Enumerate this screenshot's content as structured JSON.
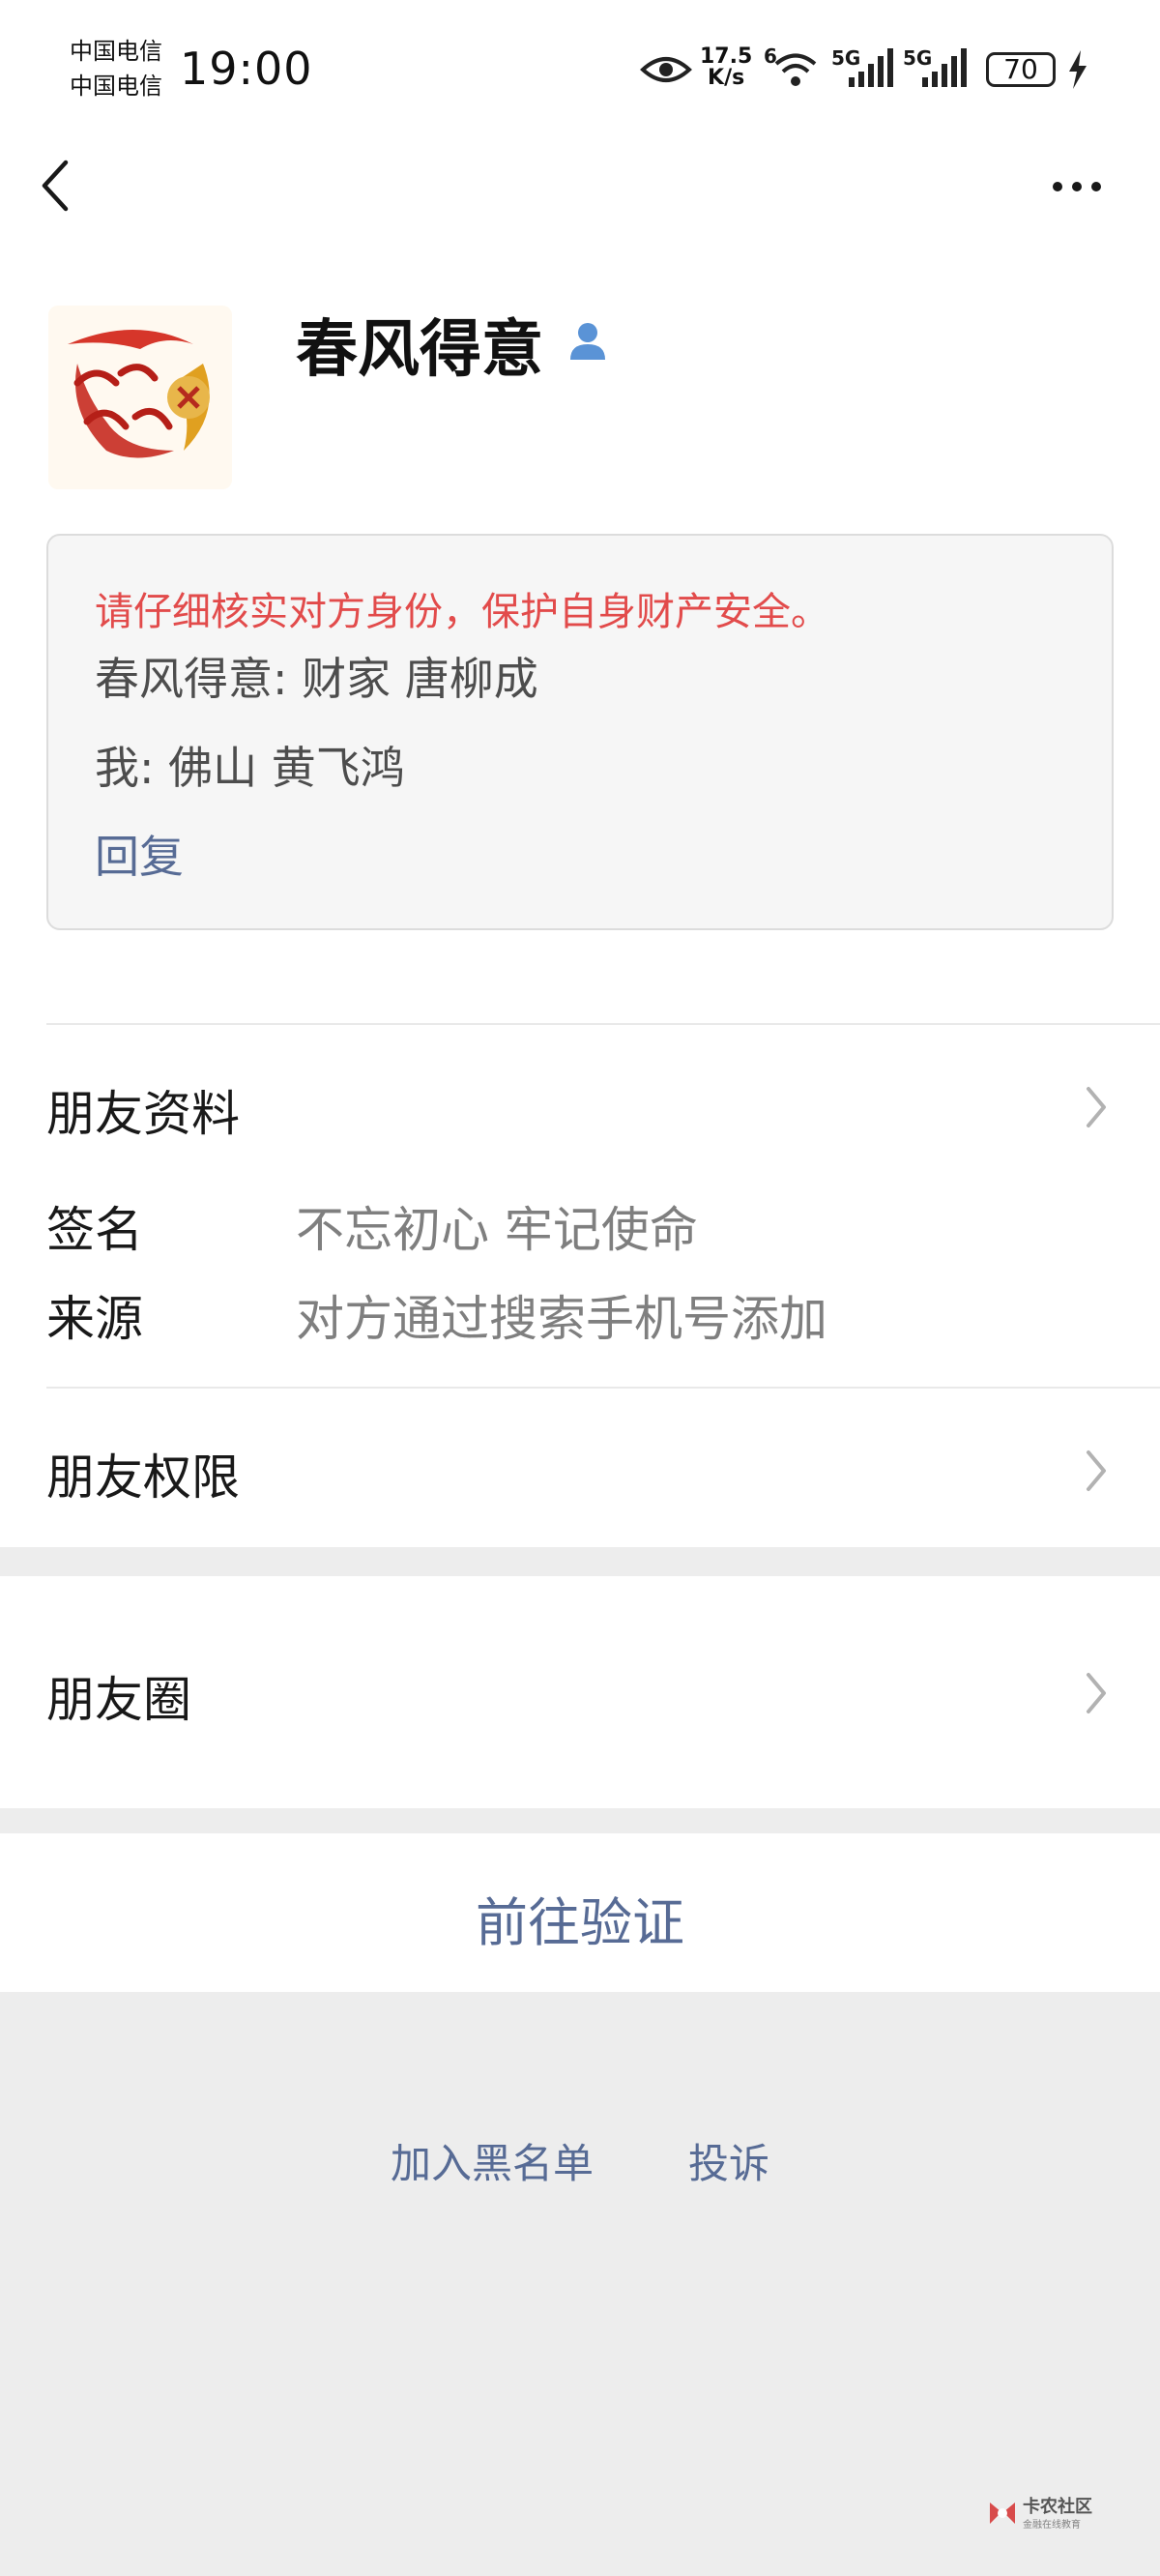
{
  "status_bar": {
    "carrier_1": "中国电信",
    "carrier_2": "中国电信",
    "time": "19:00",
    "net_speed_value": "17.5",
    "net_speed_unit": "K/s",
    "wifi_badge": "6",
    "signal_1_label": "5G",
    "signal_2_label": "5G",
    "battery": "70"
  },
  "header": {
    "nickname": "春风得意"
  },
  "notice": {
    "warning": "请仔细核实对方身份，保护自身财产安全。",
    "their_message": "春风得意: 财家  唐柳成",
    "my_message": "我: 佛山 黄飞鸿",
    "reply_label": "回复"
  },
  "profile": {
    "friend_info_label": "朋友资料",
    "signature_label": "签名",
    "signature_value": "不忘初心 牢记使命",
    "source_label": "来源",
    "source_value": "对方通过搜索手机号添加",
    "permissions_label": "朋友权限",
    "moments_label": "朋友圈"
  },
  "actions": {
    "verify_label": "前往验证",
    "blacklist_label": "加入黑名单",
    "report_label": "投诉"
  },
  "watermark": {
    "title": "卡农社区",
    "subtitle": "金融在线教育"
  },
  "colors": {
    "link": "#576b95",
    "warning": "#e24b4b",
    "background": "#ededed"
  }
}
